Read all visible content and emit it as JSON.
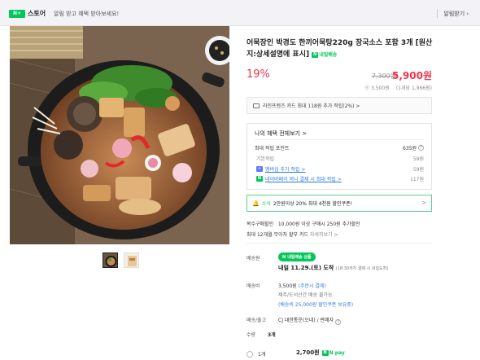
{
  "topbar": {
    "logo_badge": "N+",
    "logo_text": "스토어",
    "message": "알림 받고 혜택 받아보세요!",
    "alarm_button": "알림받기"
  },
  "product": {
    "title": "어묵장인 박경도 한끼어묵탕220g 장국소스 포함 3개 [원산지:상세설명에 표시]",
    "pay_badge": "N pay",
    "pay_badge_text": "내일배송",
    "discount": "19%",
    "original_price": "7,300원",
    "final_price": "5,900원",
    "points_note": "ⓔ 3,500원",
    "unit_price": "(1개당 1,966원)"
  },
  "card_banner": "라인프렌즈 카드 최대 118원 추가 적립(2%) >",
  "benefits": {
    "header": "나의 혜택 전체보기 >",
    "max_points_label": "최대 적립 포인트",
    "max_points_value": "635원",
    "rows": [
      {
        "label": "기본적립",
        "value": "59원"
      },
      {
        "label": "멤버십 추가 적립 >",
        "value": "59원"
      },
      {
        "label": "네이버페이 머니 결제 시 최대 적립 >",
        "value": "117원"
      }
    ]
  },
  "coupon": {
    "prefix": "소식",
    "text": "2만원이상 20% 최대 4천원 할인쿠폰!",
    "arrow": ">"
  },
  "multi_buy": {
    "label": "복수구매할인",
    "text": "10,000원 이상 구매시 250원 추가할인"
  },
  "installment": {
    "text": "최대 12개월 무이자 할부 카드",
    "link": "자세히보기 >"
  },
  "shipping": {
    "label": "배송원",
    "badge": "내일배송 상품",
    "eta": "내일 11.29.(토) 도착",
    "eta_note": "(18:30까지 결제 시 내일도착)",
    "fee_label": "배송비",
    "fee": "3,500원",
    "fee_note": "(주문시 결제)",
    "island_note": "제주/도서산간 배송 불가능",
    "free_note": "(배송비 25,000원 할인쿠폰 보유중)",
    "carrier_label": "배송/출고",
    "carrier": "CJ 대한통운(오네) / 판매자"
  },
  "quantity": {
    "label": "수량",
    "value": "3개"
  },
  "option": {
    "label": "1개",
    "price": "2,700원",
    "pay_label": "N pay"
  },
  "colors": {
    "accent_red": "#f0344d",
    "naver_green": "#03c75a",
    "link_blue": "#2c7be5"
  }
}
